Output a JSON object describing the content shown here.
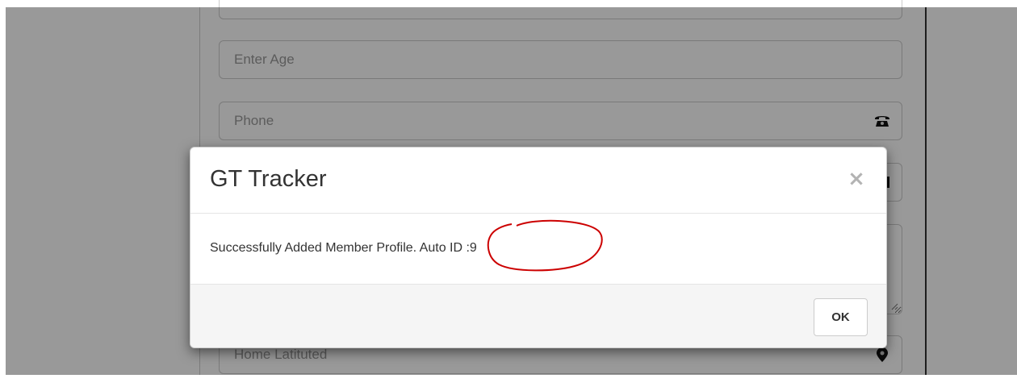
{
  "form": {
    "age_placeholder": "Enter Age",
    "phone_placeholder": "Phone",
    "home_latitude_placeholder": "Home Latituted"
  },
  "modal": {
    "title": "GT Tracker",
    "close_symbol": "×",
    "message": "Successfully Added Member Profile. Auto ID :9",
    "ok_label": "OK"
  },
  "colors": {
    "annotation": "#cc0000",
    "backdrop": "rgba(0,0,0,0.4)"
  }
}
